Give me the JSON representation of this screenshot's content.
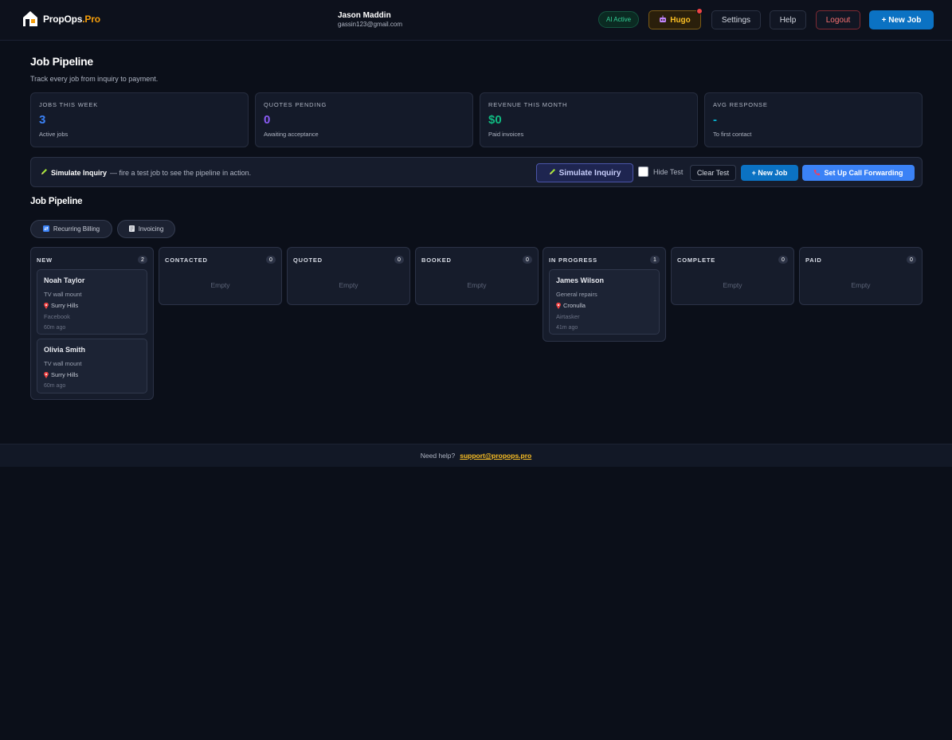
{
  "header": {
    "brand_main": "PropOps",
    "brand_accent": ".Pro",
    "user_name": "Jason Maddin",
    "user_email": "gassin123@gmail.com",
    "ai_badge": "AI Active",
    "hugo_label": "Hugo",
    "settings_label": "Settings",
    "help_label": "Help",
    "logout_label": "Logout",
    "new_job_label": "+ New Job"
  },
  "page": {
    "title": "Job Pipeline",
    "subtitle": "Track every job from inquiry to payment."
  },
  "stats": [
    {
      "label": "JOBS THIS WEEK",
      "value": "3",
      "note": "Active jobs",
      "color": "#3b82f6"
    },
    {
      "label": "QUOTES PENDING",
      "value": "0",
      "note": "Awaiting acceptance",
      "color": "#8b5cf6"
    },
    {
      "label": "REVENUE THIS MONTH",
      "value": "$0",
      "note": "Paid invoices",
      "color": "#10b981"
    },
    {
      "label": "AVG RESPONSE",
      "value": "-",
      "note": "To first contact",
      "color": "#06b6d4"
    }
  ],
  "simulate": {
    "title": "Simulate Inquiry",
    "description": "— fire a test job to see the pipeline in action.",
    "button_label": "Simulate Inquiry",
    "hide_test_label": "Hide Test",
    "hide_test_checked": false,
    "clear_test_label": "Clear Test",
    "new_job_label": "+ New Job",
    "call_forwarding_label": "Set Up Call Forwarding"
  },
  "pipeline": {
    "title": "Job Pipeline",
    "chips": [
      "Recurring Billing",
      "Invoicing"
    ],
    "empty_label": "Empty",
    "columns": [
      {
        "title": "NEW",
        "count": "2",
        "cards": [
          {
            "name": "Noah Taylor",
            "service": "TV wall mount",
            "location": "Surry Hills",
            "source": "Facebook",
            "time": "60m ago"
          },
          {
            "name": "Olivia Smith",
            "service": "TV wall mount",
            "location": "Surry Hills",
            "source": "",
            "time": "60m ago"
          }
        ]
      },
      {
        "title": "CONTACTED",
        "count": "0",
        "cards": []
      },
      {
        "title": "QUOTED",
        "count": "0",
        "cards": []
      },
      {
        "title": "BOOKED",
        "count": "0",
        "cards": []
      },
      {
        "title": "IN PROGRESS",
        "count": "1",
        "cards": [
          {
            "name": "James Wilson",
            "service": "General repairs",
            "location": "Cronulla",
            "source": "Airtasker",
            "time": "41m ago"
          }
        ]
      },
      {
        "title": "COMPLETE",
        "count": "0",
        "cards": []
      },
      {
        "title": "PAID",
        "count": "0",
        "cards": []
      }
    ]
  },
  "footer": {
    "help_text": "Need help?",
    "support_email": "support@propops.pro"
  }
}
